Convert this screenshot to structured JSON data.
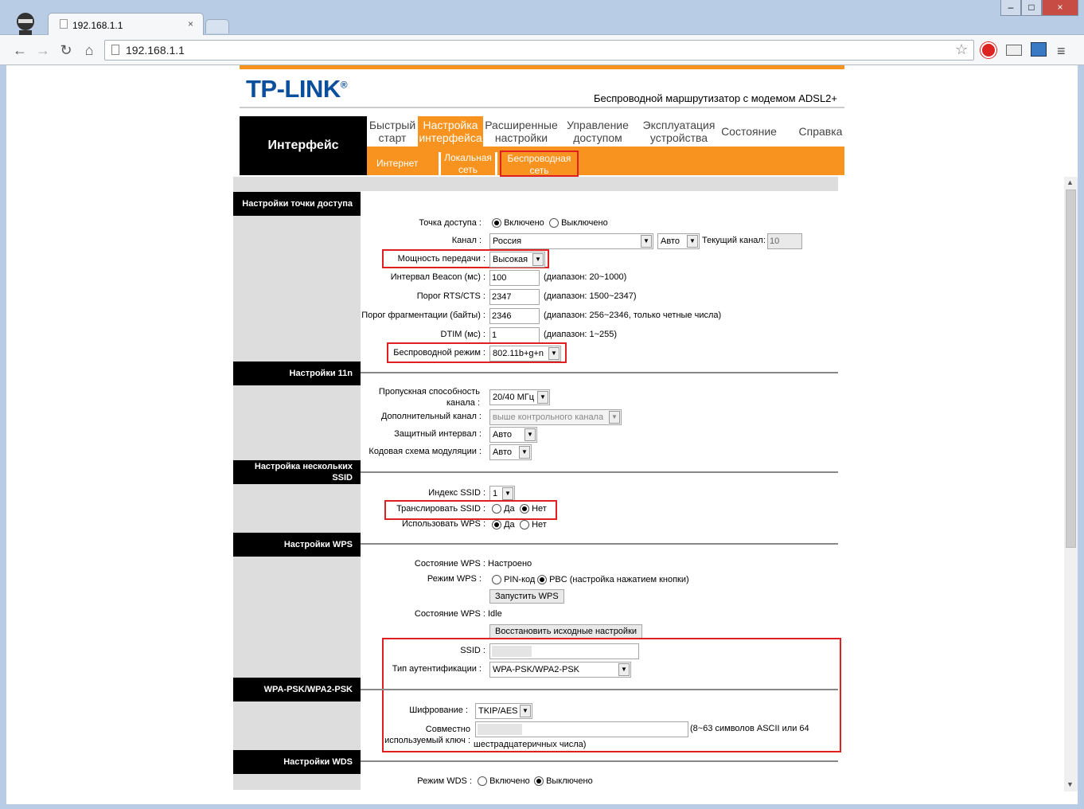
{
  "browser": {
    "tab_title": "192.168.1.1",
    "url": "192.168.1.1"
  },
  "header": {
    "logo": "TP-LINK",
    "logo_mark": "®",
    "subtitle": "Беспроводной маршрутизатор с модемом ADSL2+"
  },
  "nav": {
    "section": "Интерфейс",
    "items": [
      {
        "l1": "Быстрый",
        "l2": "старт"
      },
      {
        "l1": "Настройка",
        "l2": "интерфейса"
      },
      {
        "l1": "Расширенные",
        "l2": "настройки"
      },
      {
        "l1": "Управление",
        "l2": "доступом"
      },
      {
        "l1": "Эксплуатация",
        "l2": "устройства"
      },
      {
        "l1": "Состояние",
        "l2": ""
      },
      {
        "l1": "Справка",
        "l2": ""
      }
    ],
    "sub": [
      {
        "l1": "Интернет",
        "l2": ""
      },
      {
        "l1": "Локальная",
        "l2": "сеть"
      },
      {
        "l1": "Беспроводная",
        "l2": "сеть"
      }
    ]
  },
  "sections": {
    "ap": "Настройки точки доступа",
    "n11": "Настройки 11n",
    "multi_l1": "Настройка нескольких",
    "multi_l2": "SSID",
    "wps": "Настройки WPS",
    "wpa": "WPA-PSK/WPA2-PSK",
    "wds": "Настройки WDS"
  },
  "ap": {
    "ap_label": "Точка доступа :",
    "on": "Включено",
    "off": "Выключено",
    "channel_label": "Канал :",
    "country": "Россия",
    "channel": "Авто",
    "current_label": "Текущий канал:",
    "current": "10",
    "power_label": "Мощность передачи :",
    "power": "Высокая",
    "beacon_label": "Интервал Beacon (мс) :",
    "beacon": "100",
    "beacon_range": "(диапазон: 20~1000)",
    "rts_label": "Порог RTS/CTS :",
    "rts": "2347",
    "rts_range": "(диапазон: 1500~2347)",
    "frag_label": "Порог фрагментации (байты) :",
    "frag": "2346",
    "frag_range": "(диапазон: 256~2346, только четные числа)",
    "dtim_label": "DTIM (мс) :",
    "dtim": "1",
    "dtim_range": "(диапазон: 1~255)",
    "mode_label": "Беспроводной режим :",
    "mode": "802.11b+g+n"
  },
  "n11": {
    "bw_l1": "Пропускная способность",
    "bw_l2": "канала :",
    "bw": "20/40 МГц",
    "ext_label": "Дополнительный канал :",
    "ext": "выше контрольного канала",
    "gi_label": "Защитный интервал :",
    "gi": "Авто",
    "mcs_label": "Кодовая схема модуляции :",
    "mcs": "Авто"
  },
  "ssid": {
    "index_label": "Индекс SSID :",
    "index": "1",
    "bcast_label": "Транслировать SSID :",
    "yes": "Да",
    "no": "Нет",
    "usewps_label": "Использовать WPS :"
  },
  "wps": {
    "state_label": "Состояние WPS :",
    "state": "Настроено",
    "mode_label": "Режим WPS :",
    "pin": "PIN-код",
    "pbc": "PBC (настройка нажатием кнопки)",
    "start_btn": "Запустить WPS",
    "state2_label": "Состояние WPS :",
    "state2": "Idle",
    "reset_btn": "Восстановить исходные настройки",
    "ssid_label": "SSID :",
    "auth_label": "Тип аутентификации :",
    "auth": "WPA-PSK/WPA2-PSK"
  },
  "wpa": {
    "enc_label": "Шифрование :",
    "enc": "TKIP/AES",
    "key_l1": "Совместно",
    "key_l2": "используемый ключ :",
    "key_hint": "(8~63 символов ASCII или 64",
    "key_hint2": "шестрадцатеричных числа)"
  },
  "wds": {
    "mode_label": "Режим WDS :",
    "on": "Включено",
    "off": "Выключено"
  }
}
